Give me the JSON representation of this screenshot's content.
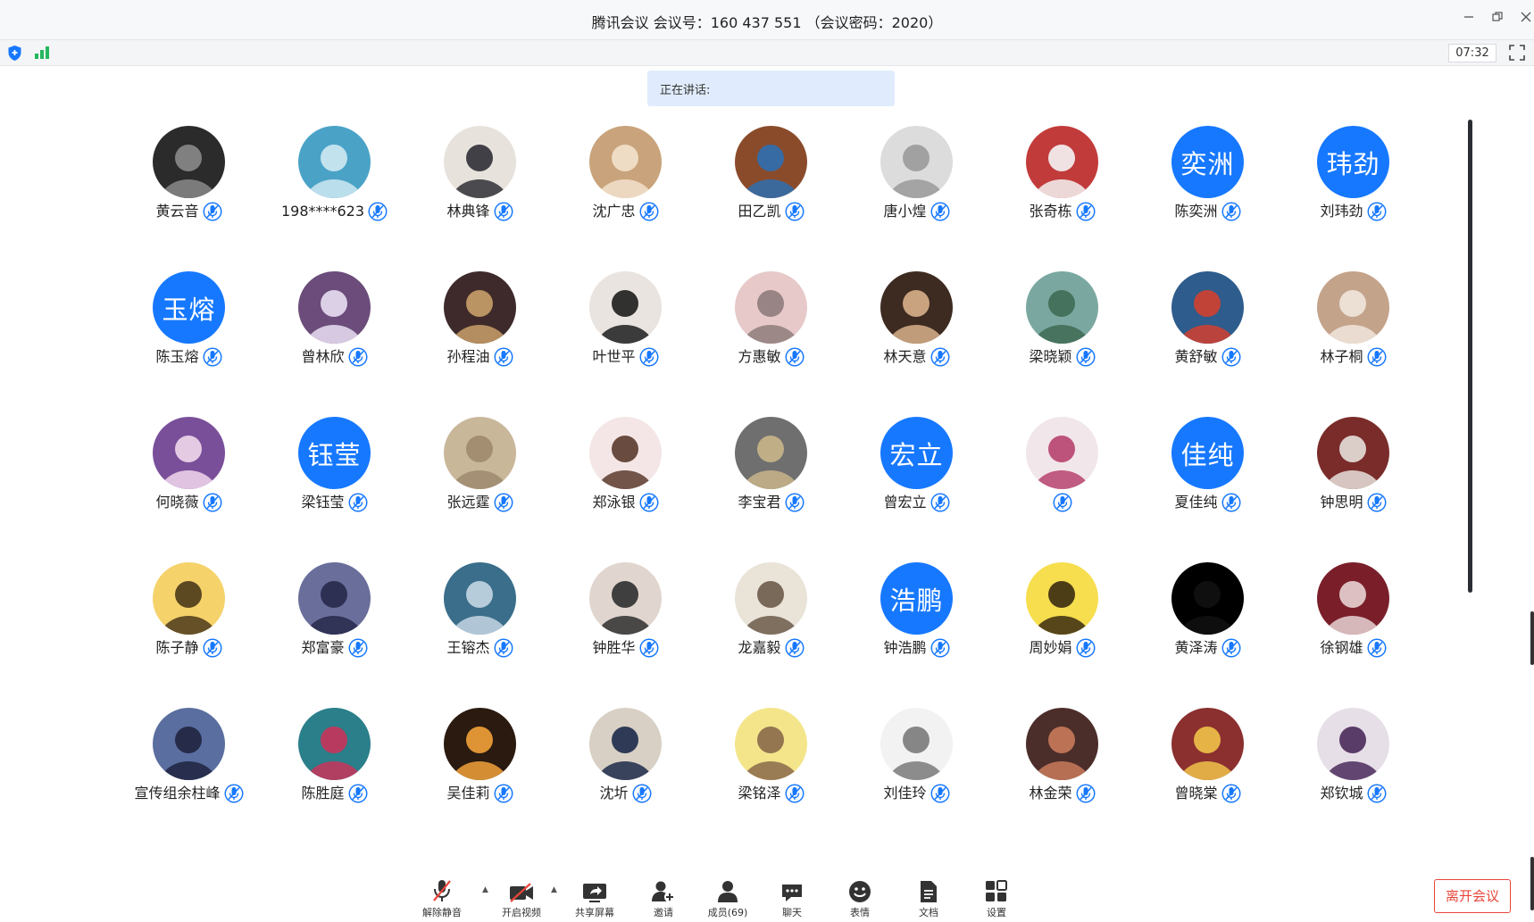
{
  "window": {
    "title": "腾讯会议 会议号：160 437 551 （会议密码：2020）",
    "timer": "07:32"
  },
  "banner": {
    "speaking_label": "正在讲话:"
  },
  "participants": [
    {
      "name": "黄云音",
      "avatar": "photo-dark-figure-icon"
    },
    {
      "name": "198****623",
      "avatar": "photo-lake-person-icon"
    },
    {
      "name": "林典锋",
      "avatar": "photo-young-man-icon"
    },
    {
      "name": "沈广忠",
      "avatar": "photo-fluffy-dog-icon"
    },
    {
      "name": "田乙凯",
      "avatar": "photo-cartoon-boy-icon"
    },
    {
      "name": "唐小煌",
      "avatar": "photo-grey-sketch-icon"
    },
    {
      "name": "张奇栋",
      "avatar": "photo-white-dog-icon"
    },
    {
      "name": "陈奕洲",
      "avatar": "text",
      "text": "奕洲"
    },
    {
      "name": "刘玮劲",
      "avatar": "text",
      "text": "玮劲"
    },
    {
      "name": "陈玉熔",
      "avatar": "text",
      "text": "玉熔"
    },
    {
      "name": "曾林欣",
      "avatar": "photo-bunny-cartoon-icon"
    },
    {
      "name": "孙程油",
      "avatar": "photo-tom-cat-icon"
    },
    {
      "name": "叶世平",
      "avatar": "photo-girl-portrait-icon"
    },
    {
      "name": "方惠敏",
      "avatar": "photo-pink-blur-icon"
    },
    {
      "name": "林天意",
      "avatar": "photo-cartoon-girl-icon"
    },
    {
      "name": "梁晓颖",
      "avatar": "photo-mountain-landscape-icon"
    },
    {
      "name": "黄舒敏",
      "avatar": "photo-basketball-court-icon"
    },
    {
      "name": "林子桐",
      "avatar": "photo-sleeping-dog-icon"
    },
    {
      "name": "何晓薇",
      "avatar": "photo-flower-bouquet-icon"
    },
    {
      "name": "梁钰莹",
      "avatar": "text",
      "text": "钰莹"
    },
    {
      "name": "张远霆",
      "avatar": "photo-cartoon-cat-face-icon"
    },
    {
      "name": "郑泳银",
      "avatar": "photo-anime-girl-icon"
    },
    {
      "name": "李宝君",
      "avatar": "photo-smiling-man-icon"
    },
    {
      "name": "曾宏立",
      "avatar": "text",
      "text": "宏立"
    },
    {
      "name": "",
      "avatar": "photo-luffy-cartoon-icon"
    },
    {
      "name": "夏佳纯",
      "avatar": "text",
      "text": "佳纯"
    },
    {
      "name": "钟思明",
      "avatar": "photo-river-landscape-icon"
    },
    {
      "name": "陈子静",
      "avatar": "photo-sticker-grid-icon"
    },
    {
      "name": "郑富豪",
      "avatar": "photo-manga-man-icon"
    },
    {
      "name": "王镕杰",
      "avatar": "photo-cartoon-duck-icon"
    },
    {
      "name": "钟胜华",
      "avatar": "photo-laughing-emoji-icon"
    },
    {
      "name": "龙嘉毅",
      "avatar": "photo-black-circle-icon"
    },
    {
      "name": "钟浩鹏",
      "avatar": "text",
      "text": "浩鹏"
    },
    {
      "name": "周妙娟",
      "avatar": "photo-2020-goals-icon"
    },
    {
      "name": "黄泽涛",
      "avatar": "photo-anime-boy-icon"
    },
    {
      "name": "徐钢雄",
      "avatar": "photo-neon-street-icon"
    },
    {
      "name": "宣传组余柱峰",
      "avatar": "photo-campfire-icon"
    },
    {
      "name": "陈胜庭",
      "avatar": "photo-one-piece-figure-icon"
    },
    {
      "name": "吴佳莉",
      "avatar": "photo-chibi-kid-icon"
    },
    {
      "name": "沈圻",
      "avatar": "photo-ghost-cartoon-icon"
    },
    {
      "name": "梁铭泽",
      "avatar": "photo-dark-room-person-icon"
    },
    {
      "name": "刘佳玲",
      "avatar": "photo-girl-yellow-hat-icon"
    },
    {
      "name": "林金荣",
      "avatar": "photo-hand-drawing-icon"
    },
    {
      "name": "曾晓棠",
      "avatar": "photo-man-outdoors-icon"
    },
    {
      "name": "郑钦城",
      "avatar": "photo-blue-anime-icon"
    }
  ],
  "toolbar": {
    "unmute": "解除静音",
    "start_video": "开启视频",
    "share_screen": "共享屏幕",
    "invite": "邀请",
    "members": "成员(69)",
    "chat": "聊天",
    "reactions": "表情",
    "docs": "文档",
    "settings": "设置",
    "leave": "离开会议"
  },
  "colors": {
    "accent": "#1678ff",
    "leave": "#e8463b",
    "banner": "#e0ecfd"
  }
}
